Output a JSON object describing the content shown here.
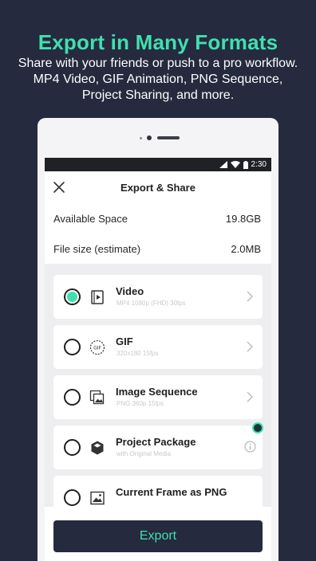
{
  "promo": {
    "title": "Export in Many Formats",
    "line1": "Share with your friends or push to a pro workflow.",
    "line2": "MP4 Video, GIF Animation, PNG Sequence,",
    "line3": "Project Sharing, and more."
  },
  "statusbar": {
    "time": "2:30"
  },
  "header": {
    "title": "Export & Share"
  },
  "info": {
    "available_label": "Available Space",
    "available_value": "19.8GB",
    "filesize_label": "File size (estimate)",
    "filesize_value": "2.0MB"
  },
  "options": [
    {
      "label": "Video",
      "sub": "MP4 1080p (FHD) 30fps",
      "icon": "video-file-icon",
      "selected": true
    },
    {
      "label": "GIF",
      "sub": "320x180 15fps",
      "icon": "gif-icon",
      "selected": false
    },
    {
      "label": "Image Sequence",
      "sub": "PNG 360p 15fps",
      "icon": "image-stack-icon",
      "selected": false
    },
    {
      "label": "Project Package",
      "sub": "with Original Media",
      "icon": "package-cube-icon",
      "selected": false
    },
    {
      "label": "Current Frame as PNG",
      "sub": "",
      "icon": "image-icon",
      "selected": false
    }
  ],
  "export_button": {
    "label": "Export"
  },
  "colors": {
    "accent": "#3fe0b0",
    "navy": "#252a3e"
  }
}
